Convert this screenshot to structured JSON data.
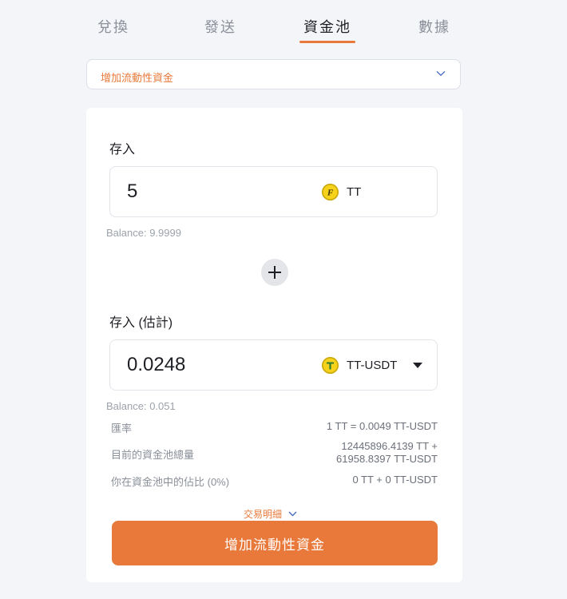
{
  "tabs": [
    {
      "label": "兌換",
      "active": false
    },
    {
      "label": "發送",
      "active": false
    },
    {
      "label": "資金池",
      "active": true
    },
    {
      "label": "數據",
      "active": false
    }
  ],
  "mode_select": {
    "label": "增加流動性資金"
  },
  "deposit": {
    "label": "存入",
    "amount": "5",
    "token": "TT",
    "balance": "Balance: 9.9999"
  },
  "deposit_estimated": {
    "label": "存入 (估計)",
    "amount": "0.0248",
    "token": "TT-USDT",
    "balance": "Balance: 0.051"
  },
  "info": {
    "rate_label": "匯率",
    "rate_value": "1 TT = 0.0049 TT-USDT",
    "pool_label": "目前的資金池總量",
    "pool_value_line1": "12445896.4139 TT +",
    "pool_value_line2": "61958.8397 TT-USDT",
    "share_label": "你在資金池中的佔比 (0%)",
    "share_value": "0 TT + 0 TT-USDT"
  },
  "details_toggle": "交易明細",
  "submit_label": "增加流動性資金",
  "icons": {
    "token_tt": "tt-token-icon",
    "token_usdt": "tether-token-icon"
  },
  "colors": {
    "accent": "#e8793a",
    "background": "#f4f5f8",
    "token_yellow": "#f7d21a"
  }
}
